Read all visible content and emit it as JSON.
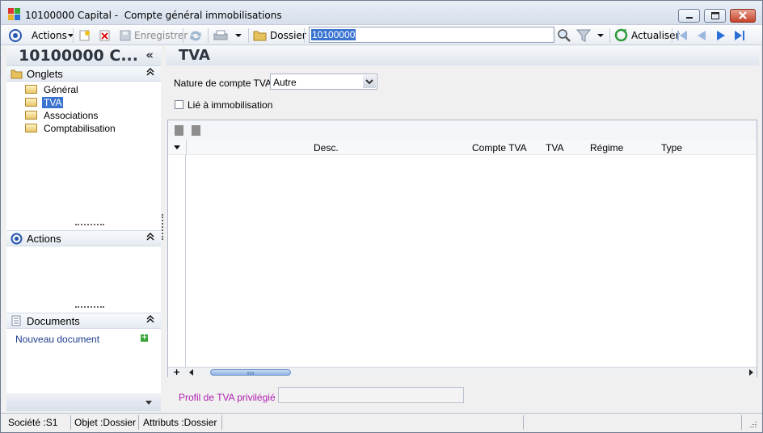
{
  "window": {
    "title": "10100000 Capital -  Compte général immobilisations",
    "minimize_icon": "minimize-icon",
    "maximize_icon": "maximize-icon",
    "close_icon": "close-icon"
  },
  "toolbar": {
    "actions_label": "Actions",
    "save_label": "Enregistrer",
    "folder_label": "Dossier",
    "search_value": "10100000",
    "refresh_label": "Actualiser"
  },
  "leftpane": {
    "title": "10100000 C...",
    "collapse_glyph": "«",
    "onglets": {
      "header": "Onglets",
      "items": [
        {
          "label": "Général",
          "selected": false
        },
        {
          "label": "TVA",
          "selected": true
        },
        {
          "label": "Associations",
          "selected": false
        },
        {
          "label": "Comptabilisation",
          "selected": false
        }
      ]
    },
    "actions": {
      "header": "Actions"
    },
    "documents": {
      "header": "Documents",
      "new_document": "Nouveau document"
    }
  },
  "main": {
    "title": "TVA",
    "nature_label": "Nature de compte TVA :",
    "nature_value": "Autre",
    "lie_label": "Lié à immobilisation",
    "grid": {
      "columns": [
        "Desc.",
        "Compte TVA",
        "TVA",
        "Régime",
        "Type"
      ],
      "rows": []
    },
    "profil_label": "Profil de TVA privilégié :",
    "profil_value": ""
  },
  "statusbar": {
    "societe": "Société :S1",
    "objet": "Objet :Dossier",
    "attributs": "Attributs :Dossier"
  },
  "colors": {
    "selection": "#3a74d0",
    "profil_label": "#b01fb0",
    "nav_blue": "#2a6fd6"
  }
}
